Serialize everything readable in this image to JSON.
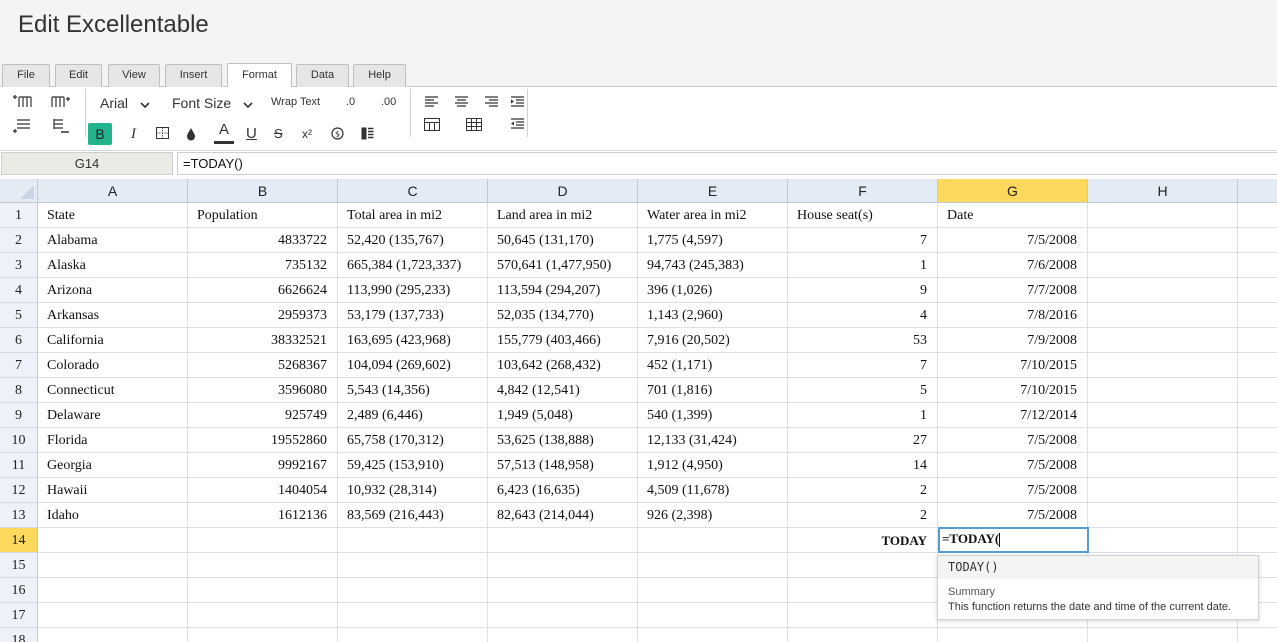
{
  "app": {
    "title": "Edit Excellentable"
  },
  "menu": {
    "tabs": [
      {
        "label": "File"
      },
      {
        "label": "Edit"
      },
      {
        "label": "View"
      },
      {
        "label": "Insert"
      },
      {
        "label": "Format"
      },
      {
        "label": "Data"
      },
      {
        "label": "Help"
      }
    ],
    "active": "Format"
  },
  "toolbar": {
    "font_family": "Arial",
    "font_size": "Font Size",
    "wrap_text": "Wrap Text",
    "decrease_decimal": ".0",
    "increase_decimal": ".00",
    "bold": "B",
    "italic": "I",
    "underline": "U",
    "strikethrough": "S",
    "superscript": "x²",
    "font_color_letter": "A",
    "accent_color": "#23b38d",
    "icons": [
      "insert-row-above-icon",
      "insert-column-icon",
      "insert-row-below-icon",
      "delete-row-icon",
      "borders-icon",
      "fill-color-icon",
      "font-color-icon",
      "currency-icon",
      "conditional-format-icon",
      "align-left-icon",
      "align-center-icon",
      "align-right-icon",
      "indent-icon",
      "merge-cells-icon",
      "table-icon",
      "outdent-icon"
    ]
  },
  "formula_bar": {
    "cell_ref": "G14",
    "formula": "=TODAY()"
  },
  "sheet": {
    "columns": [
      "A",
      "B",
      "C",
      "D",
      "E",
      "F",
      "G",
      "H"
    ],
    "selected_column": "G",
    "selected_row": "14",
    "row_numbers": [
      "1",
      "2",
      "3",
      "4",
      "5",
      "6",
      "7",
      "8",
      "9",
      "10",
      "11",
      "12",
      "13",
      "14",
      "15",
      "16",
      "17",
      "18"
    ],
    "rows": [
      [
        "State",
        "Population",
        "Total area in mi2",
        "Land area in mi2",
        "Water area in mi2",
        "House seat(s)",
        "Date",
        ""
      ],
      [
        "Alabama",
        "4833722",
        "52,420 (135,767)",
        "50,645 (131,170)",
        "1,775 (4,597)",
        "7",
        "7/5/2008",
        ""
      ],
      [
        "Alaska",
        "735132",
        "665,384 (1,723,337)",
        "570,641 (1,477,950)",
        "94,743 (245,383)",
        "1",
        "7/6/2008",
        ""
      ],
      [
        "Arizona",
        "6626624",
        "113,990 (295,233)",
        "113,594 (294,207)",
        "396 (1,026)",
        "9",
        "7/7/2008",
        ""
      ],
      [
        "Arkansas",
        "2959373",
        "53,179 (137,733)",
        "52,035 (134,770)",
        "1,143 (2,960)",
        "4",
        "7/8/2016",
        ""
      ],
      [
        "California",
        "38332521",
        "163,695 (423,968)",
        "155,779 (403,466)",
        "7,916 (20,502)",
        "53",
        "7/9/2008",
        ""
      ],
      [
        "Colorado",
        "5268367",
        "104,094 (269,602)",
        "103,642 (268,432)",
        "452 (1,171)",
        "7",
        "7/10/2015",
        ""
      ],
      [
        "Connecticut",
        "3596080",
        "5,543 (14,356)",
        "4,842 (12,541)",
        "701 (1,816)",
        "5",
        "7/10/2015",
        ""
      ],
      [
        "Delaware",
        "925749",
        "2,489 (6,446)",
        "1,949 (5,048)",
        "540 (1,399)",
        "1",
        "7/12/2014",
        ""
      ],
      [
        "Florida",
        "19552860",
        "65,758 (170,312)",
        "53,625 (138,888)",
        "12,133 (31,424)",
        "27",
        "7/5/2008",
        ""
      ],
      [
        "Georgia",
        "9992167",
        "59,425 (153,910)",
        "57,513 (148,958)",
        "1,912 (4,950)",
        "14",
        "7/5/2008",
        ""
      ],
      [
        "Hawaii",
        "1404054",
        "10,932 (28,314)",
        "6,423 (16,635)",
        "4,509 (11,678)",
        "2",
        "7/5/2008",
        ""
      ],
      [
        "Idaho",
        "1612136",
        "83,569 (216,443)",
        "82,643 (214,044)",
        "926 (2,398)",
        "2",
        "7/5/2008",
        ""
      ],
      [
        "",
        "",
        "",
        "",
        "",
        "TODAY",
        "",
        ""
      ],
      [
        "",
        "",
        "",
        "",
        "",
        "",
        "",
        ""
      ],
      [
        "",
        "",
        "",
        "",
        "",
        "",
        "",
        ""
      ],
      [
        "",
        "",
        "",
        "",
        "",
        "",
        "",
        ""
      ],
      [
        "",
        "",
        "",
        "",
        "",
        "",
        "",
        ""
      ]
    ],
    "numeric_columns": [
      1,
      5,
      6
    ]
  },
  "editor": {
    "value": "=TODAY("
  },
  "autocomplete": {
    "function": "TODAY()",
    "summary_label": "Summary",
    "summary_text": "This function returns the date and time of the current date."
  }
}
